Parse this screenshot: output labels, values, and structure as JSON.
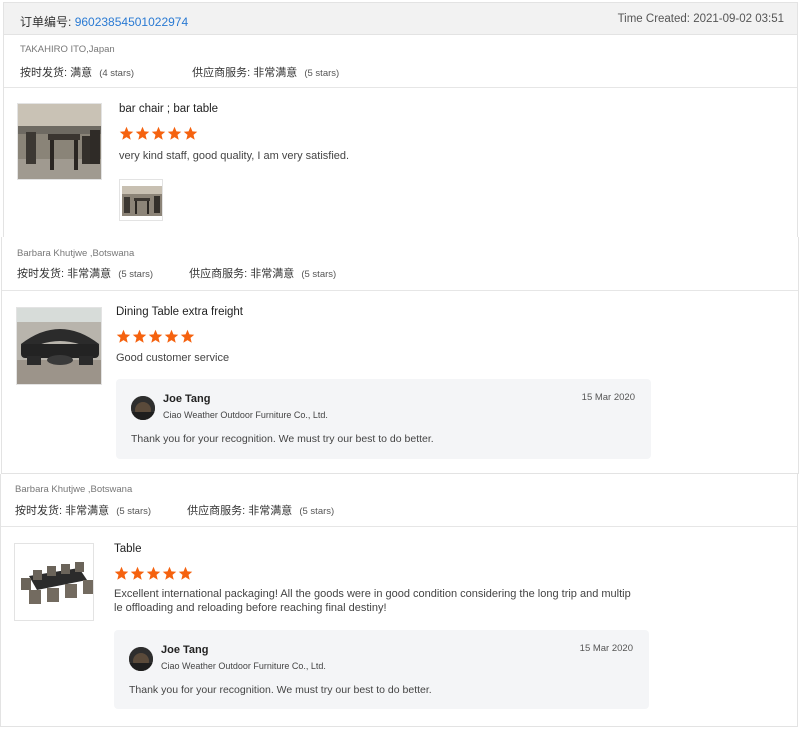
{
  "reviews": [
    {
      "order_label": "订单编号:",
      "order_number": "96023854501022974",
      "time_created": "Time Created: 2021-09-02 03:51",
      "buyer": "TAKAHIRO ITO,Japan",
      "delivery_label": "按时发货:",
      "delivery_value": "满意",
      "delivery_note": "(4 stars)",
      "service_label": "供应商服务:",
      "service_value": "非常满意",
      "service_note": "(5 stars)",
      "product": "bar chair ; bar table",
      "stars": 5,
      "comment": "very kind staff, good quality, I am very satisfied."
    },
    {
      "buyer": "Barbara Khutjwe ,Botswana",
      "delivery_label": "按时发货:",
      "delivery_value": "非常满意",
      "delivery_note": "(5 stars)",
      "service_label": "供应商服务:",
      "service_value": "非常满意",
      "service_note": "(5 stars)",
      "product": "Dining Table extra freight",
      "stars": 5,
      "comment": "Good customer service",
      "reply": {
        "name": "Joe Tang",
        "company": "Ciao Weather Outdoor Furniture Co., Ltd.",
        "date": "15 Mar 2020",
        "text": "Thank you for your recognition. We must try our best to do better."
      }
    },
    {
      "buyer": "Barbara Khutjwe ,Botswana",
      "delivery_label": "按时发货:",
      "delivery_value": "非常满意",
      "delivery_note": "(5 stars)",
      "service_label": "供应商服务:",
      "service_value": "非常满意",
      "service_note": "(5 stars)",
      "product": "Table",
      "stars": 5,
      "comment_line1": "Excellent international packaging! All the goods were in good condition considering the long trip and multip",
      "comment_line2": "le offloading and reloading before reaching final destiny!",
      "reply": {
        "name": "Joe Tang",
        "company": "Ciao Weather Outdoor Furniture Co., Ltd.",
        "date": "15 Mar 2020",
        "text": "Thank you for your recognition. We must try our best to do better."
      }
    }
  ],
  "colors": {
    "star": "#f5620f",
    "link": "#2a7ad3",
    "reply_bg": "#f4f5f7"
  },
  "icons": {
    "star": "star-icon",
    "avatar": "avatar-icon"
  }
}
